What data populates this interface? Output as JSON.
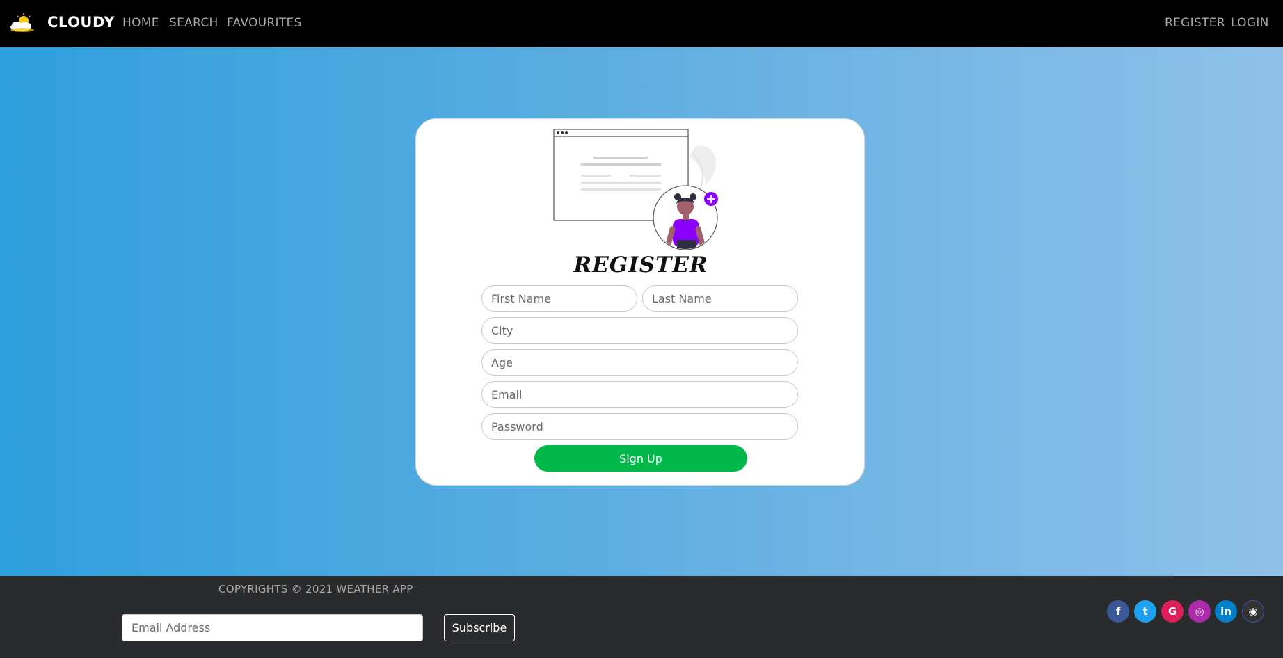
{
  "navbar": {
    "brand": "CLOUDY",
    "links": [
      "HOME",
      "SEARCH",
      "FAVOURITES"
    ],
    "right_links": [
      "REGISTER",
      "LOGIN"
    ]
  },
  "card": {
    "title": "REGISTER",
    "fields": {
      "first_name": "First Name",
      "last_name": "Last Name",
      "city": "City",
      "age": "Age",
      "email": "Email",
      "password": "Password"
    },
    "submit_label": "Sign Up"
  },
  "footer": {
    "copyright": "COPYRIGHTS © 2021 WEATHER APP",
    "newsletter_placeholder": "Email Address",
    "subscribe_label": "Subscribe",
    "social": [
      {
        "icon": "facebook-icon",
        "glyph": "f",
        "color": "#3b5998"
      },
      {
        "icon": "twitter-icon",
        "glyph": "t",
        "color": "#1da1f2"
      },
      {
        "icon": "google-icon",
        "glyph": "G",
        "color": "#dd1e5a"
      },
      {
        "icon": "instagram-icon",
        "glyph": "◎",
        "color": "#ac2bac"
      },
      {
        "icon": "linkedin-icon",
        "glyph": "in",
        "color": "#0082ca"
      },
      {
        "icon": "github-icon",
        "glyph": "◉",
        "color": "#333333"
      }
    ]
  },
  "colors": {
    "accent_green": "#00b74a",
    "avatar_purple": "#8a00ff",
    "navbar_bg": "#000000",
    "footer_bg": "#2a2b2d"
  }
}
